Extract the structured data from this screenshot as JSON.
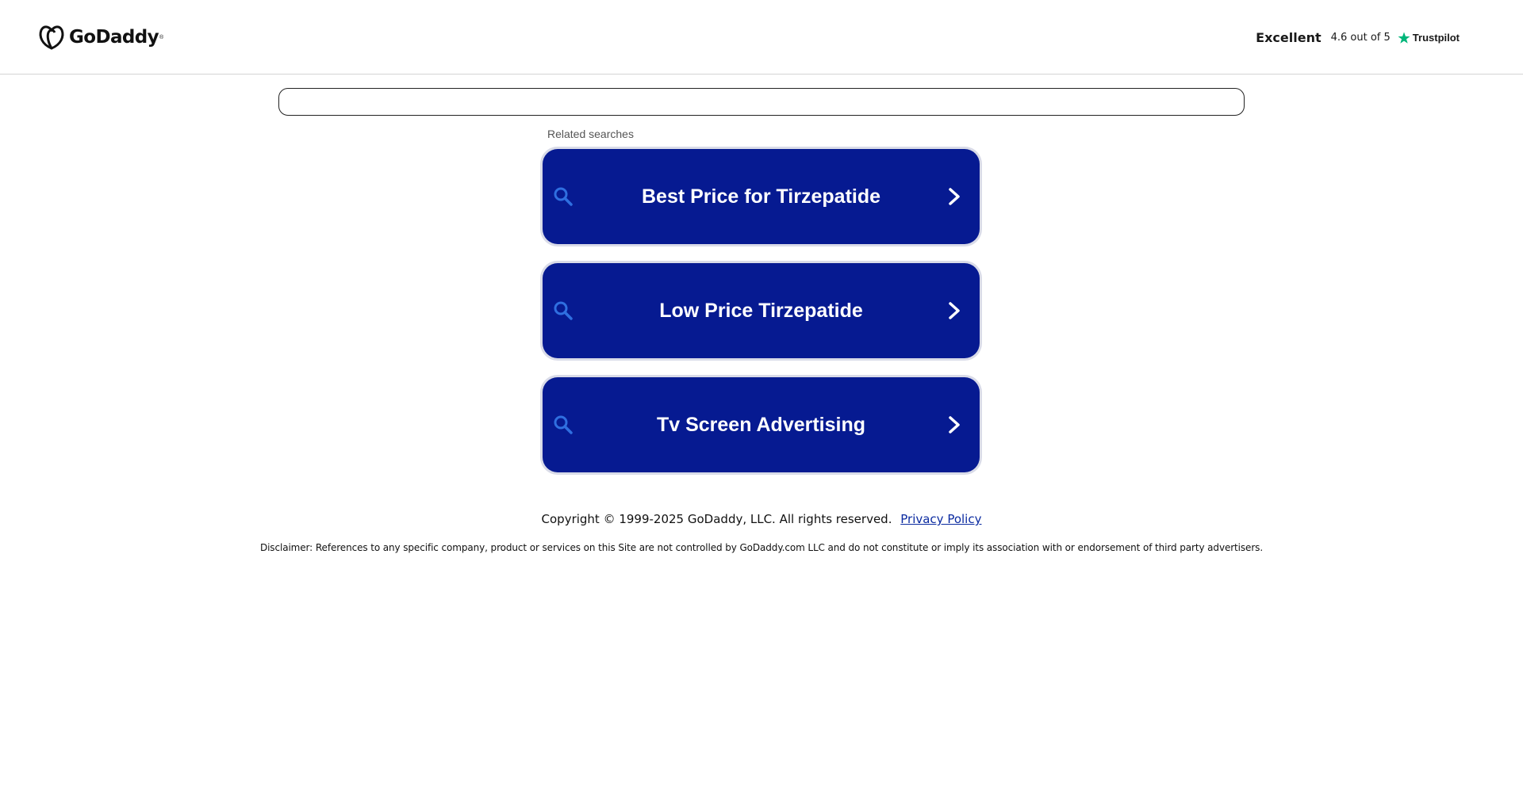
{
  "header": {
    "logo_text": "GoDaddy",
    "logo_tm": "®",
    "trust_rating_label": "Excellent",
    "trust_score": "4.6 out of 5",
    "trust_brand": "Trustpilot"
  },
  "search": {
    "value": "",
    "placeholder": ""
  },
  "related": {
    "label": "Related searches",
    "items": [
      {
        "label": "Best Price for Tirzepatide"
      },
      {
        "label": "Low Price Tirzepatide"
      },
      {
        "label": "Tv Screen Advertising"
      }
    ]
  },
  "footer": {
    "copyright": "Copyright © 1999-2025 GoDaddy, LLC. All rights reserved.",
    "privacy_link": "Privacy Policy",
    "disclaimer": "Disclaimer: References to any specific company, product or services on this Site are not controlled by GoDaddy.com LLC and do not constitute or imply its association with or endorsement of third party advertisers."
  },
  "colors": {
    "button_bg": "#061a91",
    "button_border": "#d9dbe8",
    "icon_blue": "#2f6fe0",
    "trustpilot_green": "#00b67a"
  },
  "icons": {
    "logo": "godaddy-logo-icon",
    "star": "trustpilot-star-icon",
    "search": "search-icon",
    "chevron": "chevron-right-icon"
  }
}
